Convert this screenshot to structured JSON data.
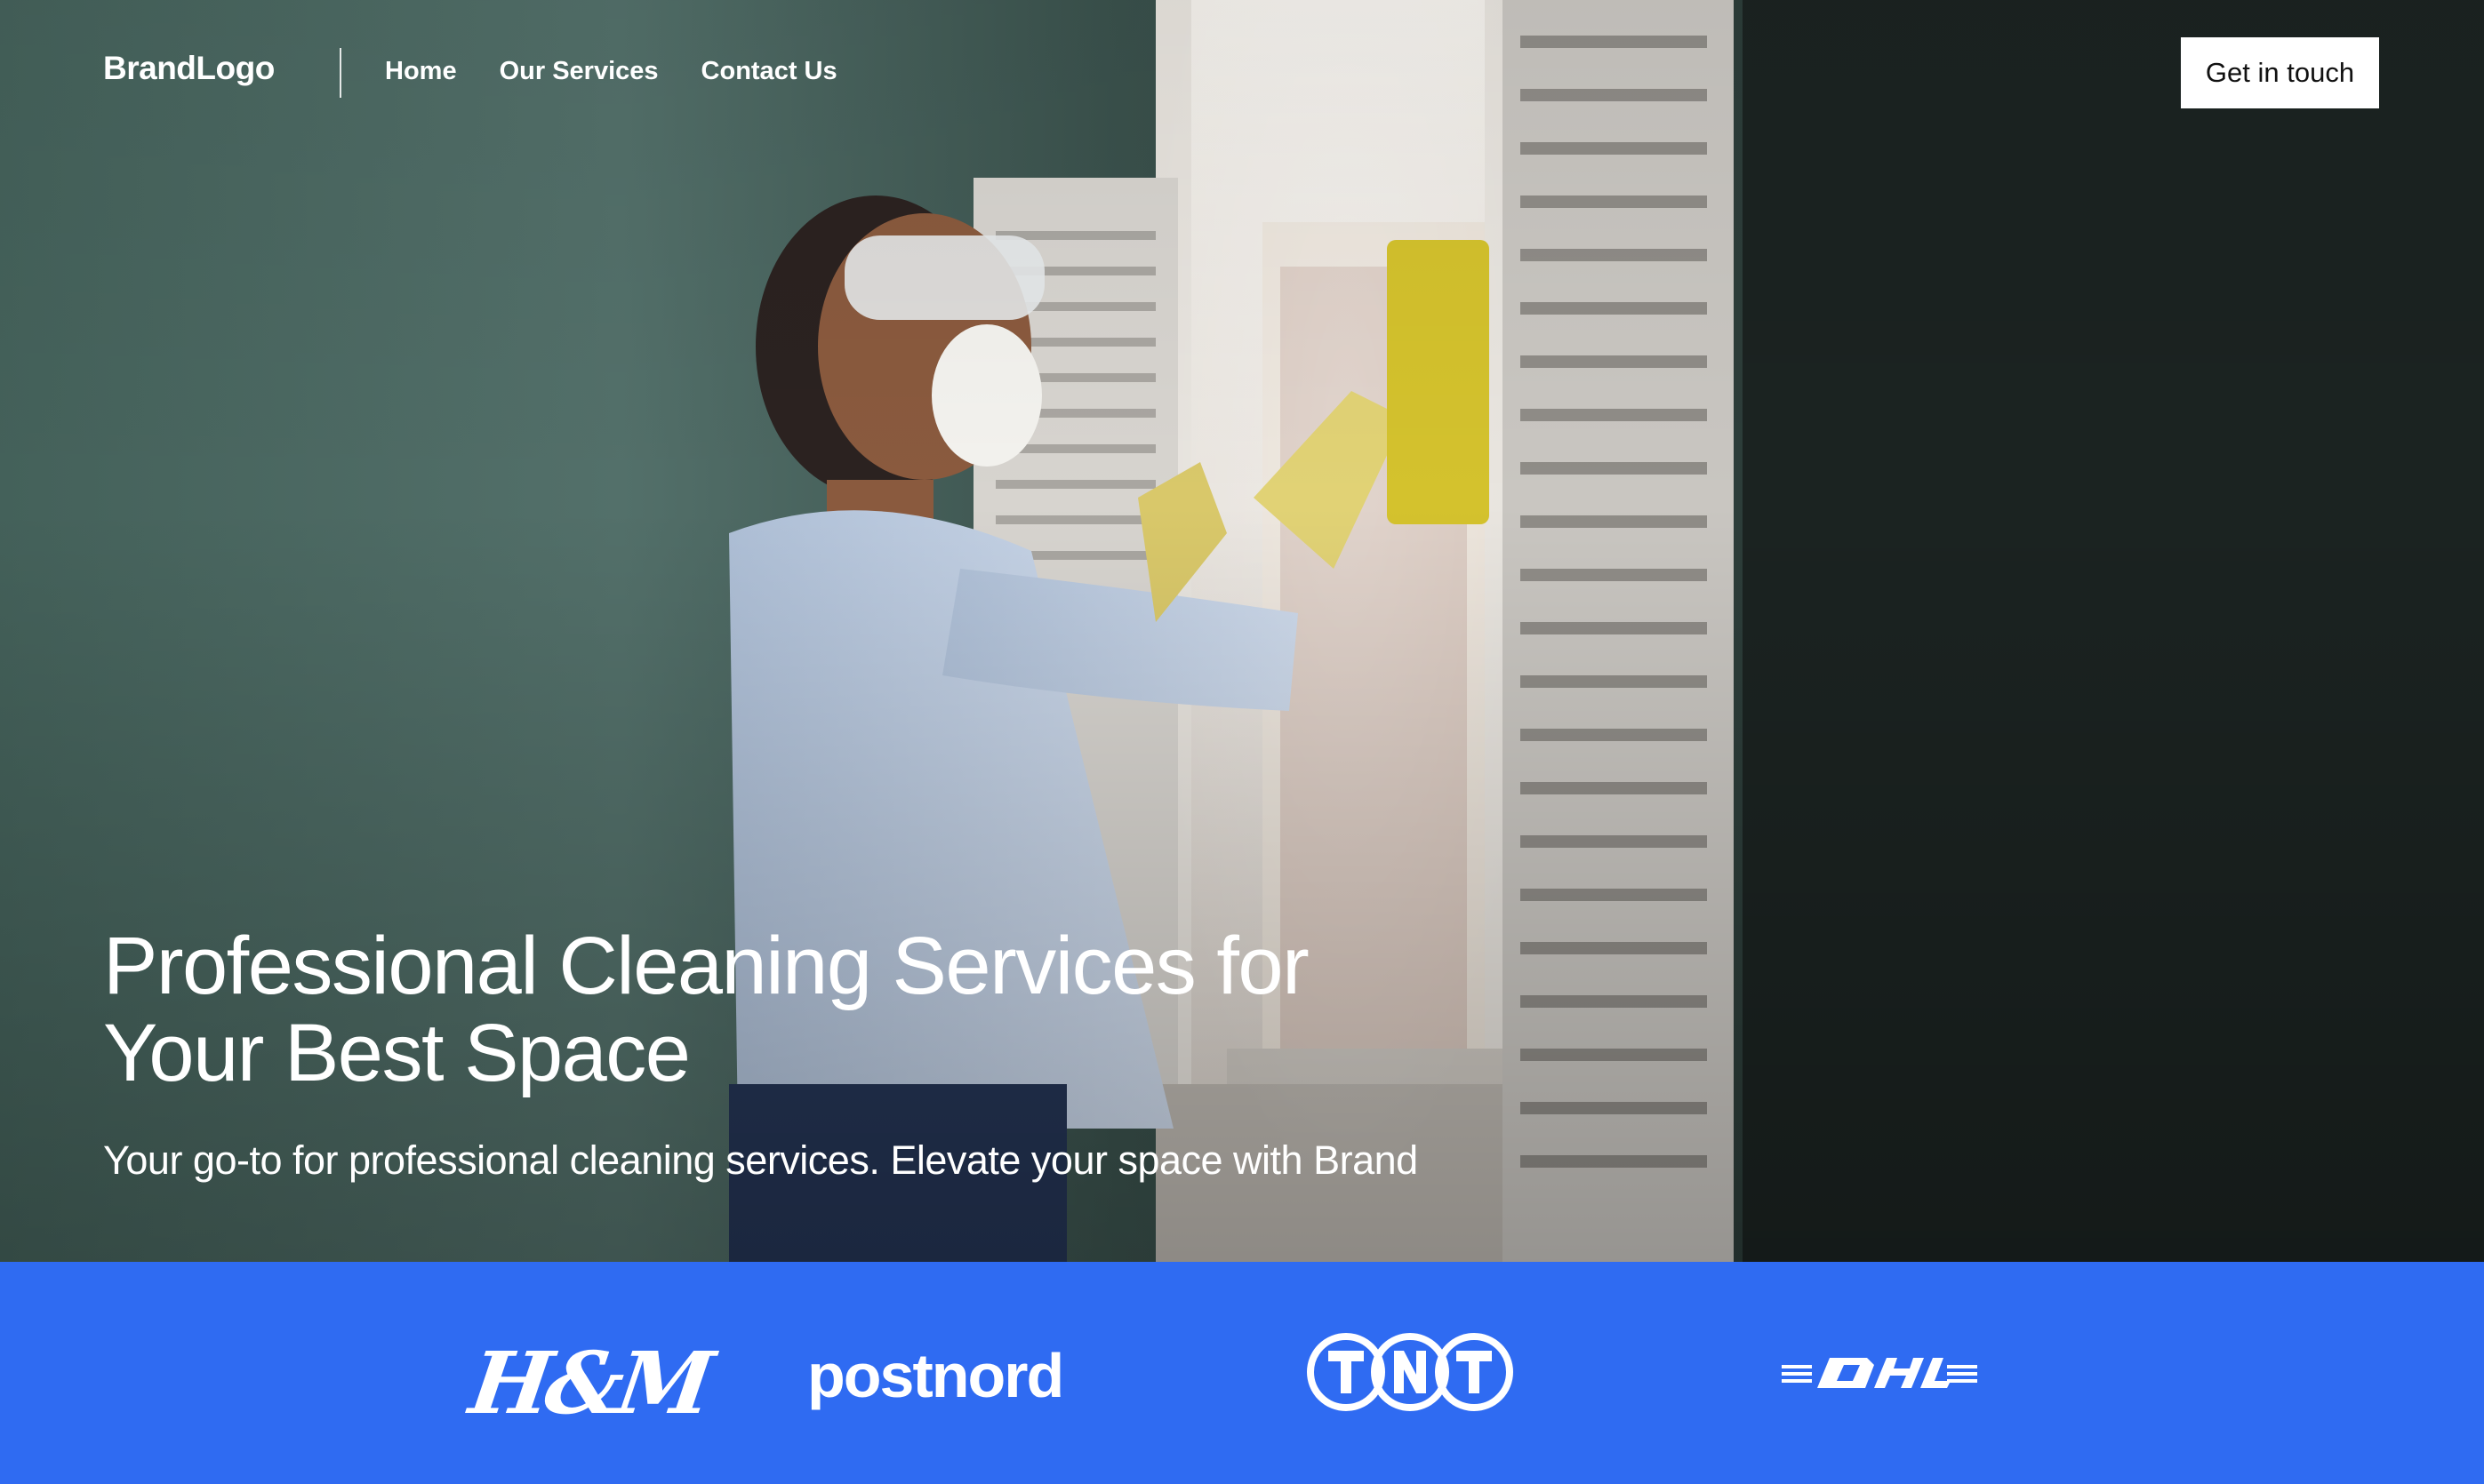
{
  "nav": {
    "brand": "BrandLogo",
    "links": [
      "Home",
      "Our Services",
      "Contact Us"
    ],
    "cta": "Get in touch"
  },
  "hero": {
    "headline_line1": "Professional Cleaning Services for",
    "headline_line2": "Your Best Space",
    "subheadline": "Your go-to for professional cleaning services. Elevate your space with Brand"
  },
  "partners": {
    "hm": "H&M",
    "postnord": "postnord",
    "tnt": "TNT",
    "dhl": "DHL"
  },
  "colors": {
    "strip": "#2f6bf2",
    "text": "#ffffff",
    "button_bg": "#ffffff"
  }
}
